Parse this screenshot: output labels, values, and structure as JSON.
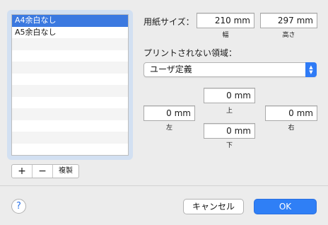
{
  "paper_list": {
    "items": [
      "A4余白なし",
      "A5余白なし"
    ],
    "selected_index": 0,
    "controls": {
      "add": "+",
      "remove": "−",
      "duplicate": "複製"
    }
  },
  "paper_size": {
    "label": "用紙サイズ：",
    "width_value": "210 mm",
    "width_caption": "幅",
    "height_value": "297 mm",
    "height_caption": "高さ"
  },
  "non_printable": {
    "label": "プリントされない領域：",
    "popup_selected": "ユーザ定義",
    "top_value": "0 mm",
    "top_caption": "上",
    "left_value": "0 mm",
    "left_caption": "左",
    "right_value": "0 mm",
    "right_caption": "右",
    "bottom_value": "0 mm",
    "bottom_caption": "下"
  },
  "footer": {
    "help": "?",
    "cancel": "キャンセル",
    "ok": "OK"
  },
  "colors": {
    "selection": "#3b79e0",
    "accent": "#2f7ff6"
  }
}
